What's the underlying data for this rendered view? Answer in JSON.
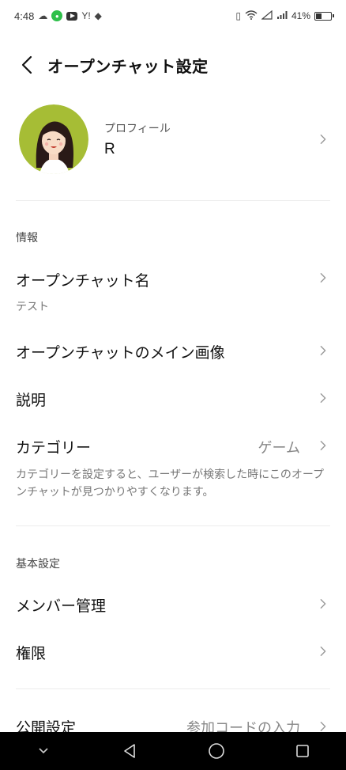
{
  "status_bar": {
    "time": "4:48",
    "battery_percent": "41%",
    "battery_level": 0.41,
    "left_icons": [
      "cloud-icon",
      "line-app-icon",
      "youtube-icon",
      "yahoo-icon",
      "shield-icon"
    ],
    "right_icons": [
      "vibrate-icon",
      "wifi-icon",
      "signal-empty-icon",
      "signal-icon"
    ],
    "yahoo_text": "Y!"
  },
  "header": {
    "title": "オープンチャット設定",
    "back_icon": "chevron-left-icon"
  },
  "profile": {
    "label": "プロフィール",
    "name": "R"
  },
  "sections": {
    "info": {
      "label": "情報",
      "chat_name_label": "オープンチャット名",
      "chat_name_value": "テスト",
      "main_image_label": "オープンチャットのメイン画像",
      "description_label": "説明",
      "category_label": "カテゴリー",
      "category_value": "ゲーム",
      "category_help": "カテゴリーを設定すると、ユーザーが検索した時にこのオープンチャットが見つかりやすくなります。"
    },
    "basic": {
      "label": "基本設定",
      "member_label": "メンバー管理",
      "permission_label": "権限",
      "public_label": "公開設定",
      "public_value": "参加コードの入力"
    }
  },
  "nav_bar": {
    "icons": [
      "chevron-down-icon",
      "back-triangle-icon",
      "home-circle-icon",
      "recents-square-icon"
    ]
  },
  "colors": {
    "avatar_bg": "#a6bd35",
    "divider": "#ececec",
    "secondary_text": "#888888"
  }
}
